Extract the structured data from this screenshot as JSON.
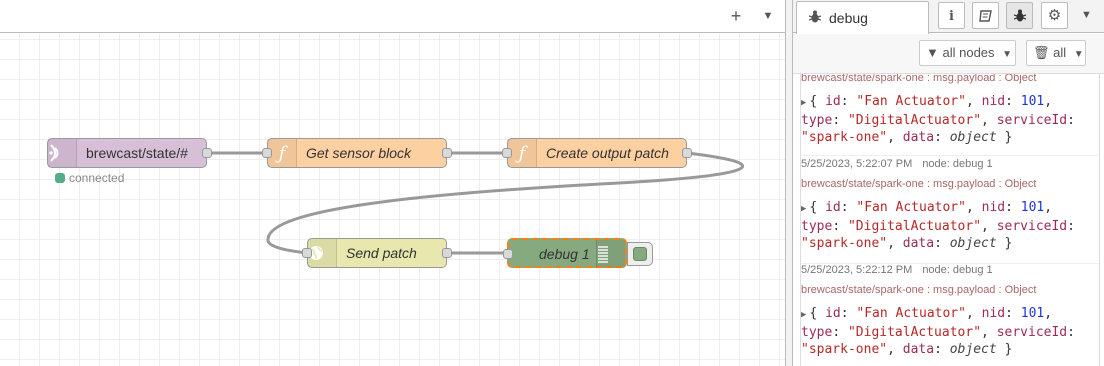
{
  "workspace": {
    "toolbar": {
      "add_icon": "plus-icon",
      "menu_icon": "caret-down-icon"
    },
    "nodes": {
      "mqtt": {
        "label": "brewcast/state/#",
        "icon": "mqtt-icon",
        "status": "connected",
        "color": "#d8bfd8"
      },
      "sensor": {
        "label": "Get sensor block",
        "icon": "function-icon",
        "color": "#fdd0a2"
      },
      "patch": {
        "label": "Create output patch",
        "icon": "function-icon",
        "color": "#fdd0a2"
      },
      "send": {
        "label": "Send patch",
        "icon": "globe-icon",
        "color": "#e7e7ae"
      },
      "debug": {
        "label": "debug 1",
        "icon": "debug-list-icon",
        "color": "#87a980"
      }
    }
  },
  "sidebar": {
    "active_tab": "debug",
    "tab_icons": [
      "info-icon",
      "book-icon",
      "bug-icon",
      "gear-icon"
    ],
    "filter": {
      "nodes_label": "all nodes",
      "clear_label": "all"
    },
    "messages": [
      {
        "date": "",
        "node": "",
        "topic": "brewcast/state/spark-one : msg.payload : Object",
        "line1": "{ id: \"Fan Actuator\", nid: 101,",
        "line2": "type: \"DigitalActuator\", serviceId:",
        "line3": "\"spark-one\", data: object }"
      },
      {
        "date": "5/25/2023, 5:22:07 PM",
        "node": "node: debug 1",
        "topic": "brewcast/state/spark-one : msg.payload : Object",
        "line1": "{ id: \"Fan Actuator\", nid: 101,",
        "line2": "type: \"DigitalActuator\", serviceId:",
        "line3": "\"spark-one\", data: object }"
      },
      {
        "date": "5/25/2023, 5:22:12 PM",
        "node": "node: debug 1",
        "topic": "brewcast/state/spark-one : msg.payload : Object",
        "line1": "{ id: \"Fan Actuator\", nid: 101,",
        "line2": "type: \"DigitalActuator\", serviceId:",
        "line3": "\"spark-one\", data: object }"
      }
    ]
  },
  "tab_debug_label": "debug"
}
